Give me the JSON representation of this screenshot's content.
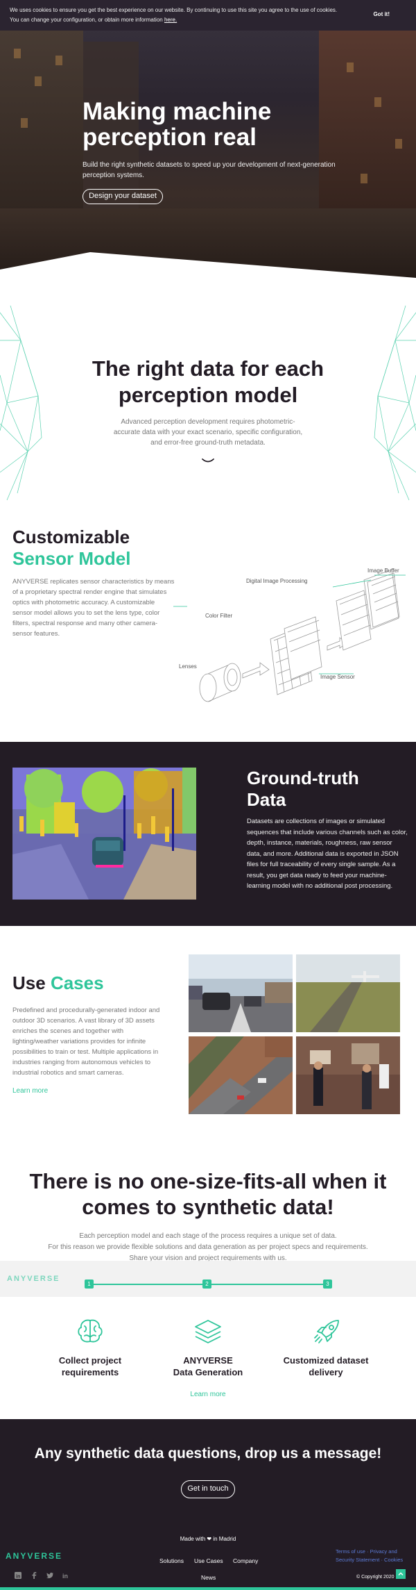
{
  "cookie": {
    "line1": "We uses cookies to ensure you get the best experience on our website. By continuing to use this site you agree to the use of cookies.",
    "line2": "You can change your configuration, or obtain more information",
    "link": "here.",
    "accept": "Got it!"
  },
  "hero": {
    "title": "Making machine perception real",
    "subtitle": "Build the right synthetic datasets to speed up your development of next-generation perception systems.",
    "button": "Design your dataset"
  },
  "intro": {
    "title": "The right data for each perception model",
    "text": "Advanced perception development requires photometric-accurate data with your exact scenario, specific configuration, and error-free ground-truth metadata."
  },
  "sensor": {
    "title_line1": "Customizable",
    "title_line2": "Sensor Model",
    "text": "ANYVERSE replicates sensor characteristics by means of a proprietary spectral render engine that simulates optics with photometric accuracy. A customizable sensor model allows you to set the lens type, color filters, spectral response and many other camera-sensor features.",
    "labels": {
      "image_buffer": "Image Buffer",
      "dip": "Digital Image Processing",
      "color_filter": "Color Filter",
      "lenses": "Lenses",
      "image_sensor": "Image Sensor"
    }
  },
  "ground_truth": {
    "title_line1": "Ground-truth",
    "title_line2": "Data",
    "text": "Datasets are collections of images or simulated sequences that include various channels such as color, depth, instance, materials, roughness, raw sensor data, and more. Additional data is exported in JSON files for full traceability of every single sample. As a result, you get data ready to feed your machine-learning model with no additional post processing."
  },
  "use_cases": {
    "title_a": "Use",
    "title_b": "Cases",
    "text": "Predefined and procedurally-generated indoor and outdoor 3D scenarios. A vast library of 3D assets enriches the scenes and together with lighting/weather variations provides for infinite possibilities to train or test. Multiple applications in industries ranging from autonomous vehicles to industrial robotics and smart cameras.",
    "link": "Learn more"
  },
  "process": {
    "title": "There is no one-size-fits-all when it comes to synthetic data!",
    "text_line1": "Each perception model and each stage of the process requires a unique set of data.",
    "text_line2": "For this reason we provide flexible solutions and data generation as per project specs and requirements.",
    "text_line3": "Share your vision and project requirements with us.",
    "overlay_logo": "ANYVERSE",
    "steps": [
      {
        "num": "1",
        "label_line1": "Collect project",
        "label_line2": "requirements",
        "icon": "brain-icon"
      },
      {
        "num": "2",
        "label_line1": "ANYVERSE",
        "label_line2": "Data Generation",
        "icon": "layers-icon"
      },
      {
        "num": "3",
        "label_line1": "Customized dataset",
        "label_line2": "delivery",
        "icon": "rocket-icon"
      }
    ],
    "link": "Learn more"
  },
  "cta": {
    "title": "Any synthetic data questions, drop us a message!",
    "button": "Get in touch"
  },
  "footer": {
    "made_prefix": "Made with",
    "made_suffix": "in Madrid",
    "logo": "ANYVERSE",
    "nav": [
      "Solutions",
      "Use Cases",
      "Company",
      "News"
    ],
    "legal_line1": "Terms of use · Privacy and",
    "legal_line2": "Security Statement · Cookies",
    "copyright": "© Copyright 2020",
    "social": [
      "linkedin-icon",
      "facebook-icon",
      "twitter-icon",
      "linkedin-in-icon"
    ]
  },
  "colors": {
    "accent": "#2ec59a",
    "dark": "#231c25"
  }
}
